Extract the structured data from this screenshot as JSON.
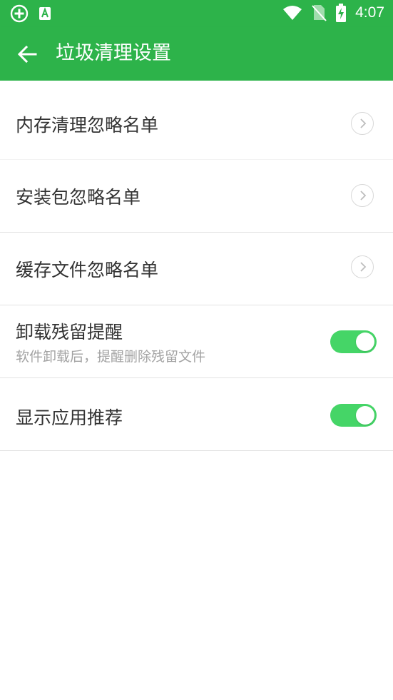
{
  "status_bar": {
    "time": "4:07",
    "left_icons": [
      "add-circle-icon",
      "text-a-icon"
    ],
    "right_icons": [
      "wifi-icon",
      "no-sim-icon",
      "battery-charging-icon"
    ]
  },
  "app_bar": {
    "title": "垃圾清理设置",
    "back_icon": "arrow-left-icon"
  },
  "settings": [
    {
      "label": "内存清理忽略名单",
      "control": "chevron"
    },
    {
      "label": "安装包忽略名单",
      "control": "chevron"
    },
    {
      "label": "缓存文件忽略名单",
      "control": "chevron"
    },
    {
      "label": "卸载残留提醒",
      "subtitle": "软件卸载后，提醒删除残留文件",
      "control": "toggle",
      "enabled": true
    },
    {
      "label": "显示应用推荐",
      "control": "toggle",
      "enabled": true
    }
  ],
  "colors": {
    "primary_green": "#2db34a",
    "toggle_on": "#45d567",
    "text_primary": "#333333",
    "text_secondary": "#a3a3a3"
  }
}
